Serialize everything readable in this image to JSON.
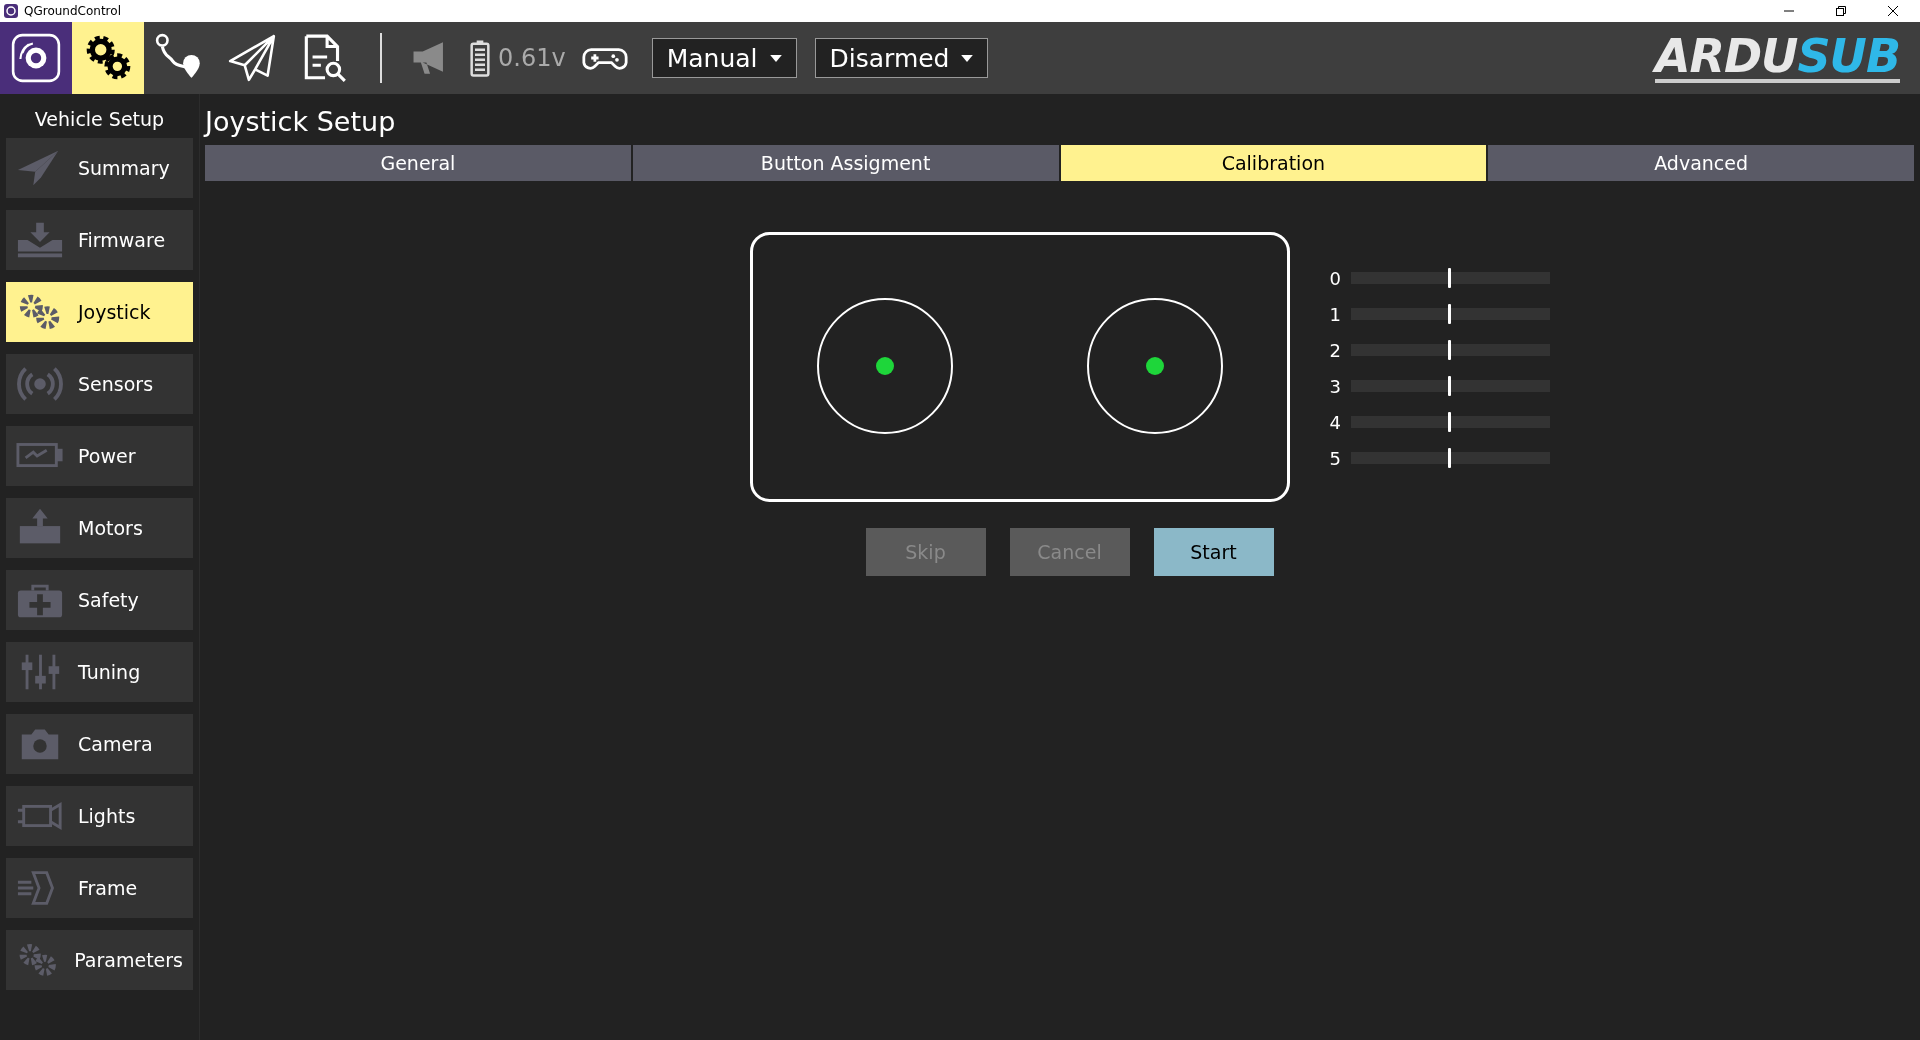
{
  "window": {
    "title": "QGroundControl"
  },
  "toolbar": {
    "views": [
      {
        "selected": false
      },
      {
        "selected": true
      },
      {
        "selected": false
      },
      {
        "selected": false
      },
      {
        "selected": false
      }
    ],
    "battery": "0.61v",
    "flight_mode": "Manual",
    "arm_state": "Disarmed",
    "logo": {
      "part_1": "ARDU",
      "part_2": "SUB"
    }
  },
  "sidebar": {
    "title": "Vehicle Setup",
    "items": [
      {
        "label": "Summary",
        "selected": false
      },
      {
        "label": "Firmware",
        "selected": false
      },
      {
        "label": "Joystick",
        "selected": true
      },
      {
        "label": "Sensors",
        "selected": false
      },
      {
        "label": "Power",
        "selected": false
      },
      {
        "label": "Motors",
        "selected": false
      },
      {
        "label": "Safety",
        "selected": false
      },
      {
        "label": "Tuning",
        "selected": false
      },
      {
        "label": "Camera",
        "selected": false
      },
      {
        "label": "Lights",
        "selected": false
      },
      {
        "label": "Frame",
        "selected": false
      },
      {
        "label": "Parameters",
        "selected": false
      }
    ]
  },
  "page": {
    "title": "Joystick Setup",
    "tabs": [
      {
        "label": "General",
        "selected": false
      },
      {
        "label": "Button Assigment",
        "selected": false
      },
      {
        "label": "Calibration",
        "selected": true
      },
      {
        "label": "Advanced",
        "selected": false
      }
    ],
    "axes": [
      {
        "label": "0",
        "level": 0.5
      },
      {
        "label": "1",
        "level": 0.5
      },
      {
        "label": "2",
        "level": 0.5
      },
      {
        "label": "3",
        "level": 0.5
      },
      {
        "label": "4",
        "level": 0.5
      },
      {
        "label": "5",
        "level": 0.5
      }
    ],
    "buttons": [
      {
        "label": "Skip",
        "disabled": true
      },
      {
        "label": "Cancel",
        "disabled": true
      },
      {
        "label": "Start",
        "disabled": false
      }
    ]
  }
}
